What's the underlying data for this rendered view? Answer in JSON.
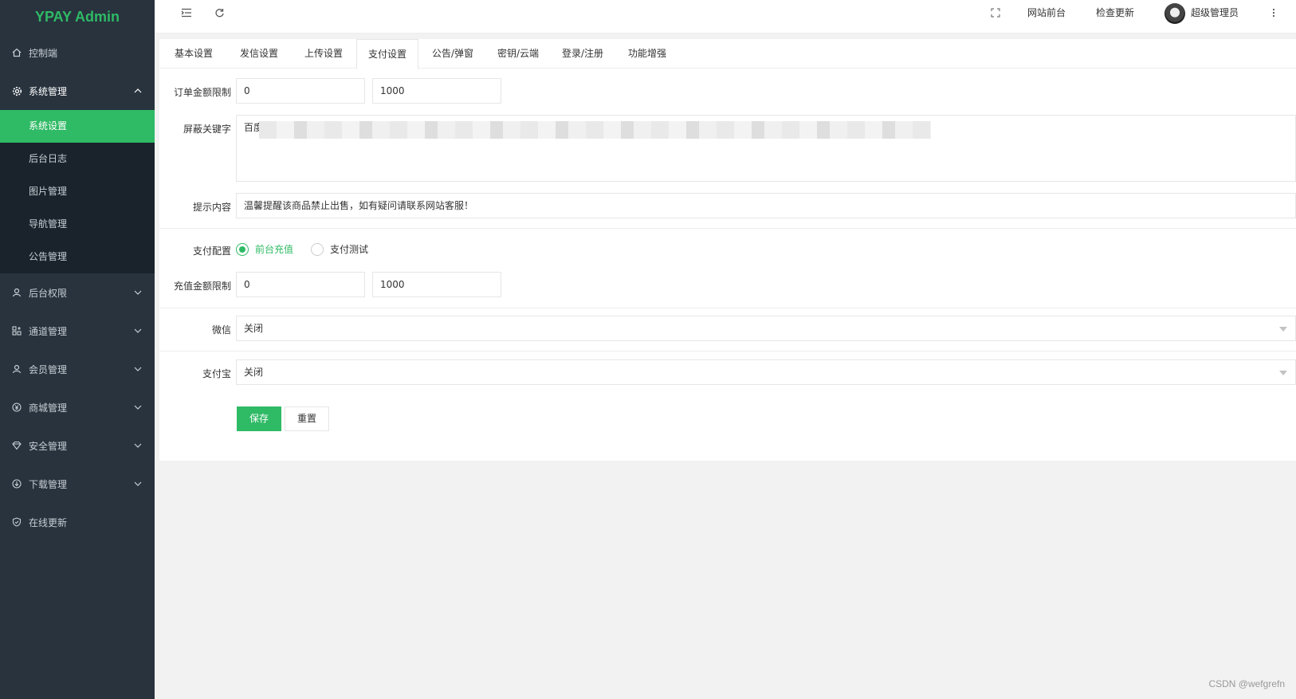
{
  "app": {
    "logo": "YPAY Admin"
  },
  "sidebar": {
    "items": [
      {
        "label": "控制端",
        "icon": "home-icon"
      },
      {
        "label": "系统管理",
        "icon": "gear-icon",
        "open": true,
        "children": [
          "系统设置",
          "后台日志",
          "图片管理",
          "导航管理",
          "公告管理"
        ],
        "active_child": "系统设置"
      },
      {
        "label": "后台权限",
        "icon": "user-icon"
      },
      {
        "label": "通道管理",
        "icon": "channel-icon"
      },
      {
        "label": "会员管理",
        "icon": "member-icon"
      },
      {
        "label": "商城管理",
        "icon": "yen-icon"
      },
      {
        "label": "安全管理",
        "icon": "diamond-icon"
      },
      {
        "label": "下载管理",
        "icon": "download-icon"
      },
      {
        "label": "在线更新",
        "icon": "shield-check-icon"
      }
    ]
  },
  "header": {
    "site_front": "网站前台",
    "check_update": "检查更新",
    "username": "超级管理员"
  },
  "tabs": [
    "基本设置",
    "发信设置",
    "上传设置",
    "支付设置",
    "公告/弹窗",
    "密钥/云端",
    "登录/注册",
    "功能增强"
  ],
  "active_tab": "支付设置",
  "form": {
    "order_limit_label": "订单金额限制",
    "order_min": "0",
    "order_max": "1000",
    "blocked_keywords_label": "屏蔽关键字",
    "blocked_keywords_visible": "百度",
    "tip_label": "提示内容",
    "tip_value": "温馨提醒该商品禁止出售，如有疑问请联系网站客服！",
    "pay_config_label": "支付配置",
    "pay_options": [
      "前台充值",
      "支付测试"
    ],
    "pay_selected": "前台充值",
    "recharge_limit_label": "充值金额限制",
    "recharge_min": "0",
    "recharge_max": "1000",
    "wechat_label": "微信",
    "wechat_value": "关闭",
    "alipay_label": "支付宝",
    "alipay_value": "关闭",
    "save_label": "保存",
    "reset_label": "重置"
  },
  "watermark": "CSDN @wefgrefn",
  "colors": {
    "accent": "#2fba65",
    "sidebar_bg": "#28333e",
    "submenu_bg": "#1a232c"
  }
}
